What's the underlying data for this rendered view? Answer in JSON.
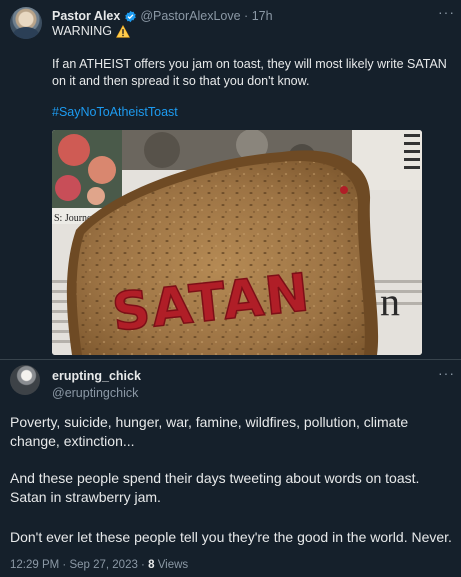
{
  "tweet": {
    "author_name": "Pastor Alex",
    "author_handle": "@PastorAlexLove",
    "time": "17h",
    "warning": "WARNING",
    "body": "If an ATHEIST offers you jam on toast, they will most likely write SATAN on it and then spread it so that you don't know.",
    "hashtag": "#SayNoToAtheistToast",
    "image": {
      "jam_text": "SATAN",
      "newspaper_text": "S: Journeyc"
    }
  },
  "reply": {
    "author_name": "erupting_chick",
    "author_handle": "@eruptingchick",
    "paragraphs": [
      "Poverty, suicide, hunger, war, famine, wildfires, pollution, climate change, extinction...",
      "And these people spend their days tweeting about words on toast. Satan in strawberry jam.",
      "Don't ever let these people tell you they're the good in the world. Never."
    ],
    "timestamp": "12:29 PM · Sep 27, 2023 · ",
    "views_count": "8",
    "views_label": " Views"
  },
  "colors": {
    "background": "#15202b",
    "text": "#e7e9ea",
    "muted": "#8b98a5",
    "link": "#1d9bf0",
    "verified": "#1d9bf0",
    "jam": "#b01e27"
  },
  "icons": [
    "verified-badge-icon",
    "warning-icon",
    "more-icon",
    "avatar"
  ]
}
